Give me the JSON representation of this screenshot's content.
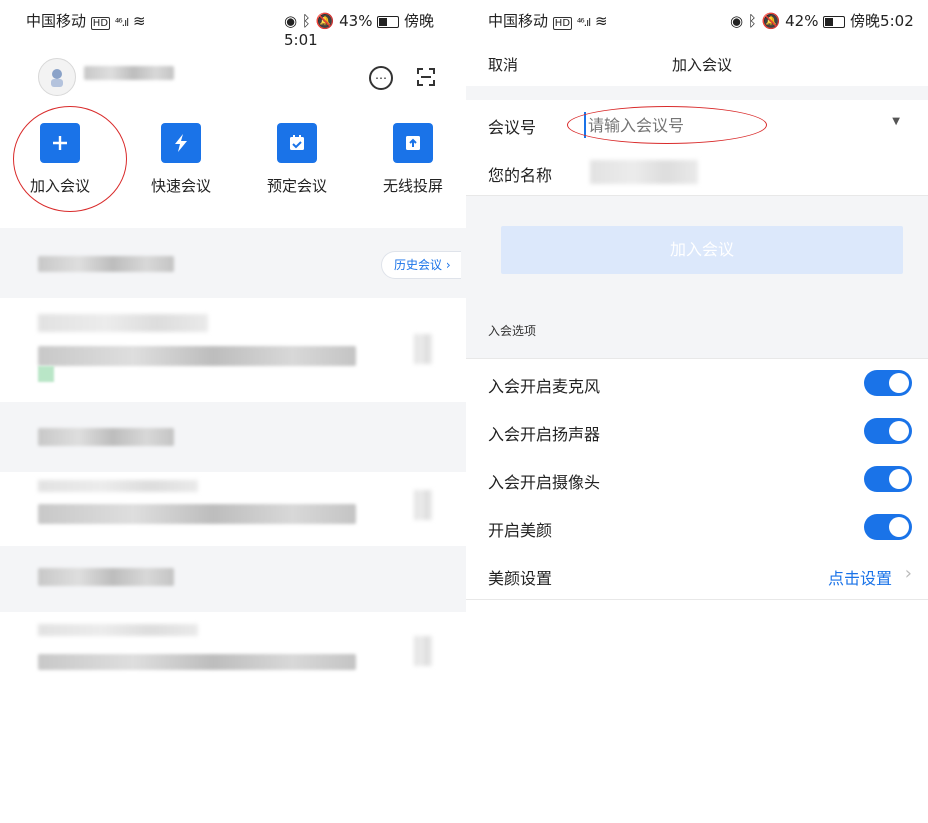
{
  "left": {
    "status": {
      "carrier": "中国移动",
      "network": "⁴⁶.ıl",
      "battery": "43%",
      "time": "傍晚5:01"
    },
    "quick_actions": [
      {
        "label": "加入会议",
        "icon": "plus-icon"
      },
      {
        "label": "快速会议",
        "icon": "lightning-icon"
      },
      {
        "label": "预定会议",
        "icon": "calendar-check-icon"
      },
      {
        "label": "无线投屏",
        "icon": "screen-cast-icon"
      }
    ],
    "history_button": "历史会议 ›"
  },
  "right": {
    "status": {
      "carrier": "中国移动",
      "network": "⁴⁶.ıl",
      "battery": "42%",
      "time": "傍晚5:02"
    },
    "nav": {
      "cancel": "取消",
      "title": "加入会议"
    },
    "form": {
      "meeting_id_label": "会议号",
      "meeting_id_placeholder": "请输入会议号",
      "name_label": "您的名称"
    },
    "join_button": "加入会议",
    "options_header": "入会选项",
    "options": [
      {
        "label": "入会开启麦克风",
        "on": true
      },
      {
        "label": "入会开启扬声器",
        "on": true
      },
      {
        "label": "入会开启摄像头",
        "on": true
      },
      {
        "label": "开启美颜",
        "on": true
      }
    ],
    "beauty": {
      "label": "美颜设置",
      "action": "点击设置"
    }
  },
  "colors": {
    "accent": "#1a73e8",
    "annotation": "#d92b2b",
    "toggle_on": "#1a73e8"
  }
}
